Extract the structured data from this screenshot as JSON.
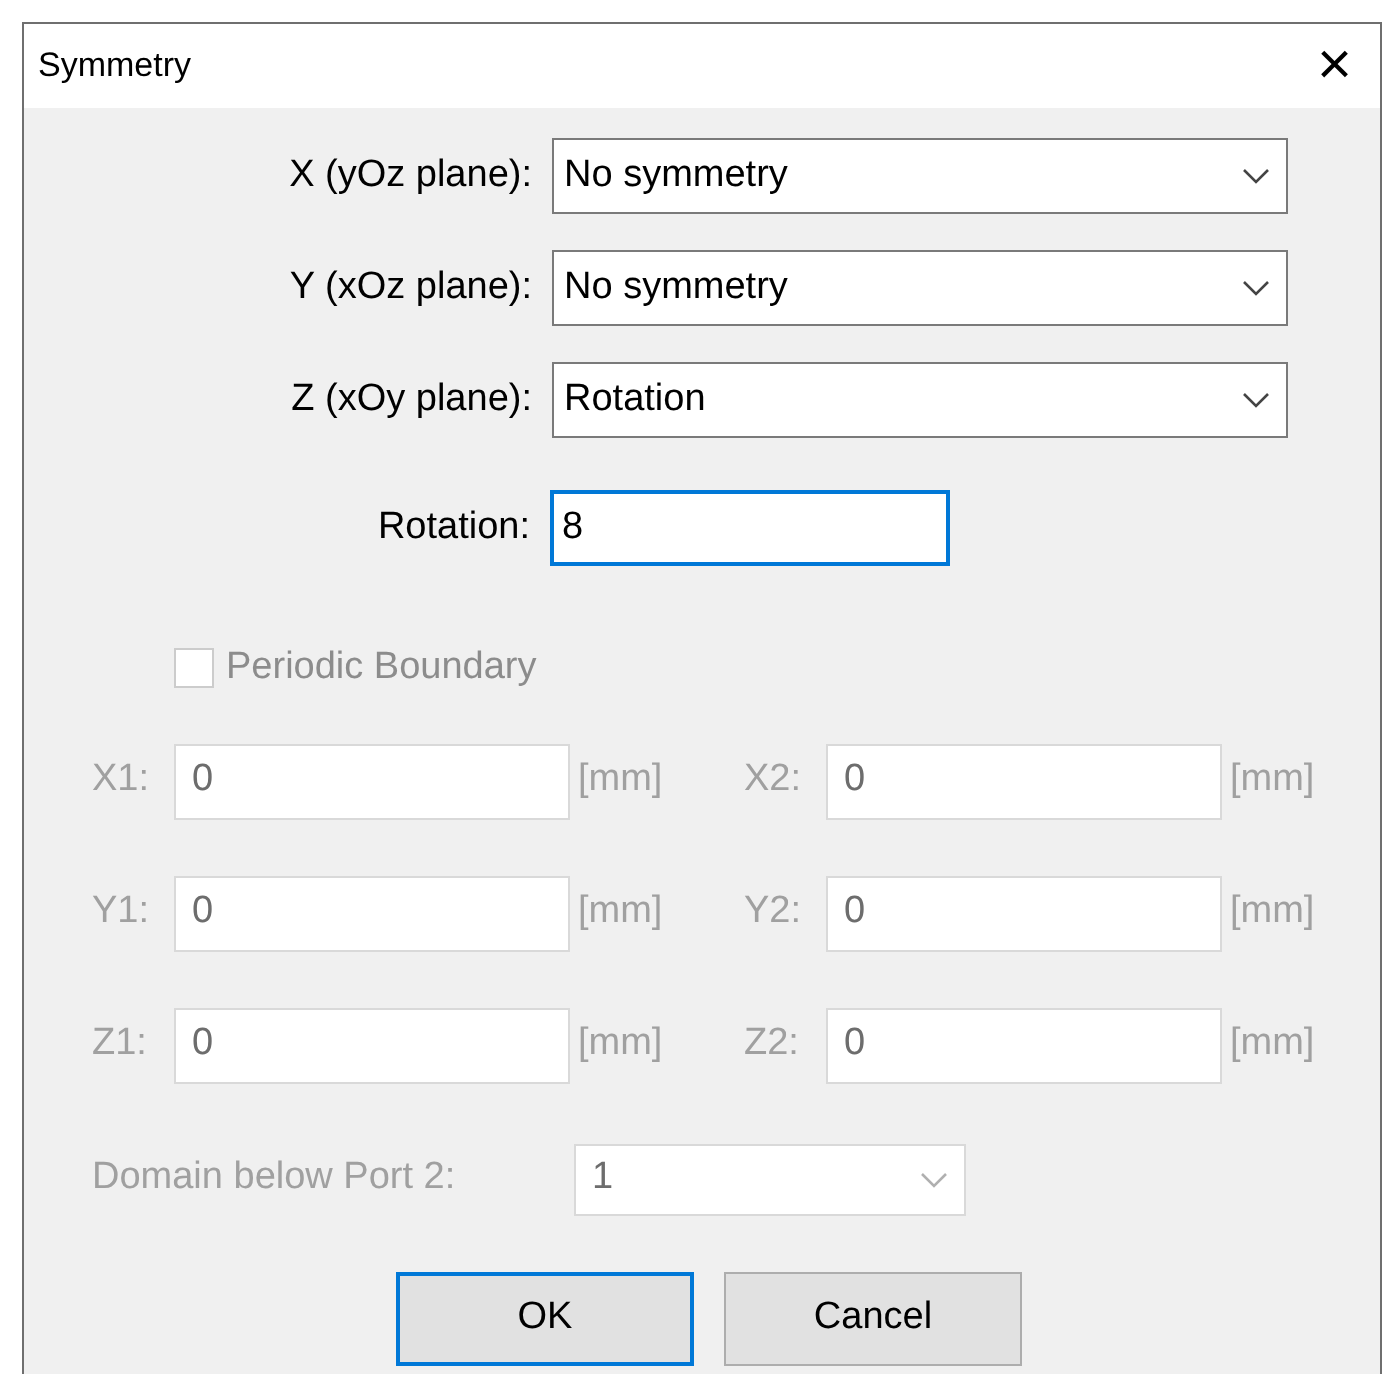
{
  "window": {
    "title": "Symmetry",
    "close": "×"
  },
  "planes": [
    {
      "label": "X (yOz plane):",
      "value": "No symmetry"
    },
    {
      "label": "Y (xOz plane):",
      "value": "No symmetry"
    },
    {
      "label": "Z (xOy plane):",
      "value": "Rotation"
    }
  ],
  "rotation": {
    "label": "Rotation:",
    "value": "8",
    "focused": true
  },
  "periodic_boundary": {
    "label": "Periodic Boundary",
    "checked": false,
    "disabled": true
  },
  "coordinates": [
    {
      "label": "X1:",
      "value": "0",
      "unit": "[mm]",
      "disabled": true
    },
    {
      "label": "X2:",
      "value": "0",
      "unit": "[mm]",
      "disabled": true
    },
    {
      "label": "Y1:",
      "value": "0",
      "unit": "[mm]",
      "disabled": true
    },
    {
      "label": "Y2:",
      "value": "0",
      "unit": "[mm]",
      "disabled": true
    },
    {
      "label": "Z1:",
      "value": "0",
      "unit": "[mm]",
      "disabled": true
    },
    {
      "label": "Z2:",
      "value": "0",
      "unit": "[mm]",
      "disabled": true
    }
  ],
  "domain": {
    "label": "Domain below Port 2:",
    "value": "1",
    "disabled": true
  },
  "buttons": [
    {
      "label": "OK",
      "default": true
    },
    {
      "label": "Cancel",
      "default": false
    }
  ]
}
